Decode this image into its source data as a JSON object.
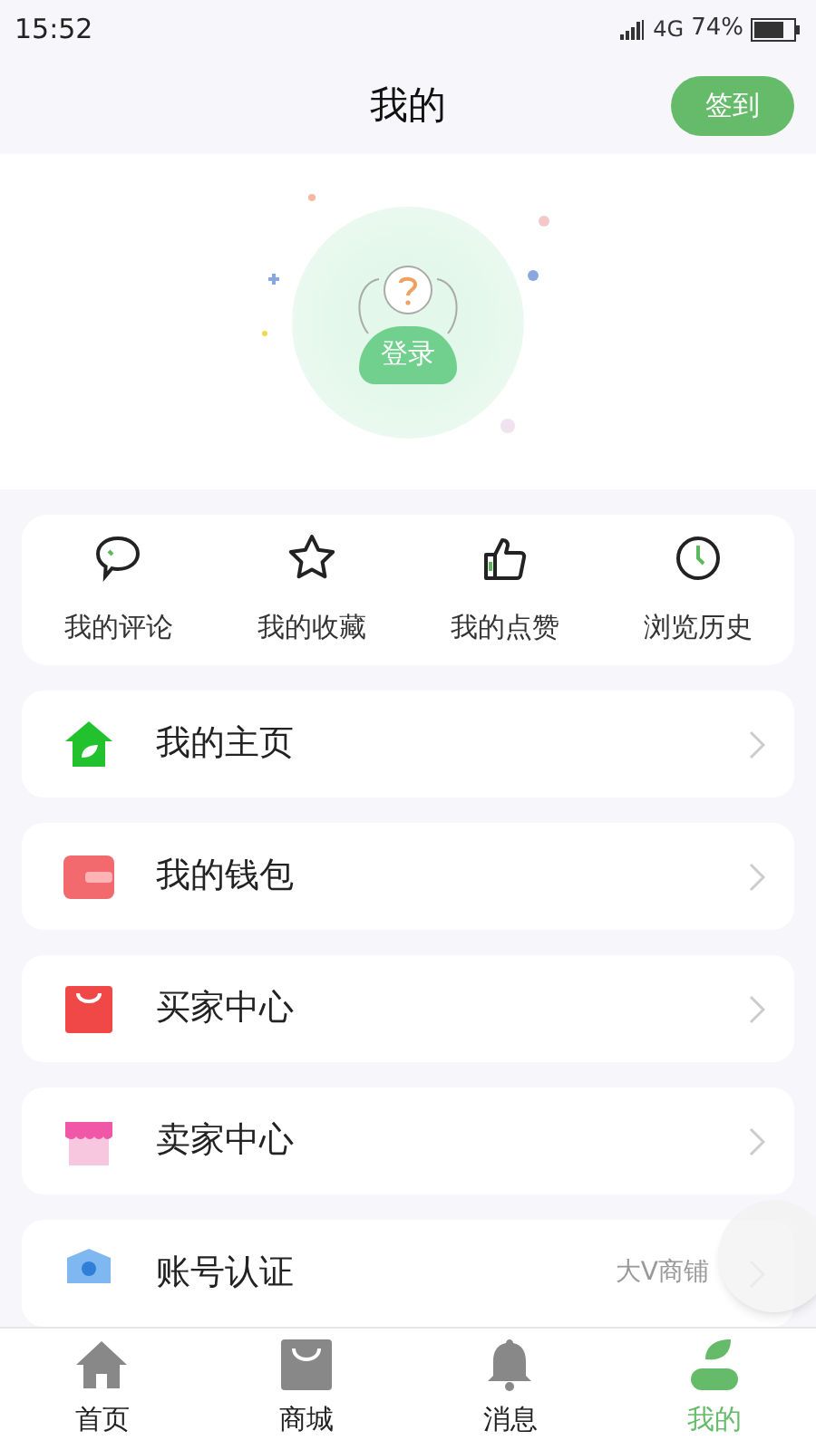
{
  "status_bar": {
    "time": "15:52",
    "network": "4G",
    "battery": "74%"
  },
  "header": {
    "title": "我的",
    "checkin_button": "签到"
  },
  "profile": {
    "login_button": "登录"
  },
  "shortcuts": [
    {
      "label": "我的评论",
      "kind": "comment"
    },
    {
      "label": "我的收藏",
      "kind": "star"
    },
    {
      "label": "我的点赞",
      "kind": "like"
    },
    {
      "label": "浏览历史",
      "kind": "history"
    }
  ],
  "menu": [
    {
      "label": "我的主页",
      "kind": "home"
    },
    {
      "label": "我的钱包",
      "kind": "wallet"
    },
    {
      "label": "买家中心",
      "kind": "buyer"
    },
    {
      "label": "卖家中心",
      "kind": "seller"
    },
    {
      "label": "账号认证",
      "kind": "verify",
      "value": "大V商铺"
    }
  ],
  "tab_bar": [
    {
      "label": "首页",
      "kind": "home",
      "selected": false
    },
    {
      "label": "商城",
      "kind": "shop",
      "selected": false
    },
    {
      "label": "消息",
      "kind": "bell",
      "selected": false
    },
    {
      "label": "我的",
      "kind": "me",
      "selected": true
    }
  ]
}
